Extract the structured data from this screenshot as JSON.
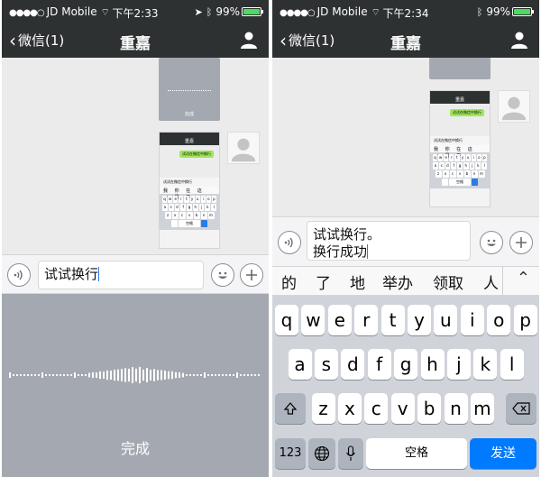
{
  "left": {
    "status": {
      "carrier": "JD Mobile",
      "time": "下午2:33",
      "battery": "99%"
    },
    "nav": {
      "back_label": "微信(1)",
      "title": "重嘉"
    },
    "voice_thumb_done": "完成",
    "thumb": {
      "nav_title": "重嘉",
      "bubble": "试试在微信中换行",
      "input": "试试在微信中换行",
      "candidates": "我 你 在 这 一 是 不",
      "rows": [
        [
          "q",
          "w",
          "e",
          "r",
          "t",
          "y",
          "u",
          "i",
          "o",
          "p"
        ],
        [
          "a",
          "s",
          "d",
          "f",
          "g",
          "h",
          "j",
          "k",
          "l"
        ],
        [
          "z",
          "x",
          "c",
          "v",
          "b",
          "n",
          "m"
        ]
      ],
      "space": "空格"
    },
    "input_text": "试试换行",
    "voice_done": "完成"
  },
  "right": {
    "status": {
      "carrier": "JD Mobile",
      "time": "下午2:34",
      "battery": "99%"
    },
    "nav": {
      "back_label": "微信(1)",
      "title": "重嘉"
    },
    "thumb": {
      "nav_title": "重嘉",
      "bubble": "试试在微信中换行",
      "input": "试试在微信中换行",
      "candidates": "我 你 在 这 一 是 不",
      "rows": [
        [
          "q",
          "w",
          "e",
          "r",
          "t",
          "y",
          "u",
          "i",
          "o",
          "p"
        ],
        [
          "a",
          "s",
          "d",
          "f",
          "g",
          "h",
          "j",
          "k",
          "l"
        ],
        [
          "z",
          "x",
          "c",
          "v",
          "b",
          "n",
          "m"
        ]
      ],
      "space": "空格"
    },
    "input_line1": "试试换行。",
    "input_line2": "换行成功",
    "candidates": [
      "的",
      "了",
      "地",
      "举办",
      "领取",
      "人"
    ],
    "keyboard": {
      "row1": [
        "q",
        "w",
        "e",
        "r",
        "t",
        "y",
        "u",
        "i",
        "o",
        "p"
      ],
      "row2": [
        "a",
        "s",
        "d",
        "f",
        "g",
        "h",
        "j",
        "k",
        "l"
      ],
      "row3": [
        "z",
        "x",
        "c",
        "v",
        "b",
        "n",
        "m"
      ],
      "num_key": "123",
      "space_key": "空格",
      "send_key": "发送"
    }
  },
  "colors": {
    "bar": "#2e3132",
    "chat_bg": "#ebebeb",
    "bubble_green": "#a0e75a",
    "send_blue": "#007aff",
    "voice_gray": "#a4a9b1"
  },
  "icons": [
    "back-chevron-icon",
    "person-icon",
    "voice-icon",
    "emoji-icon",
    "plus-icon",
    "shift-icon",
    "delete-icon",
    "globe-icon",
    "mic-icon",
    "chevron-up-icon",
    "wifi-icon",
    "bluetooth-icon",
    "location-icon",
    "battery-icon"
  ]
}
